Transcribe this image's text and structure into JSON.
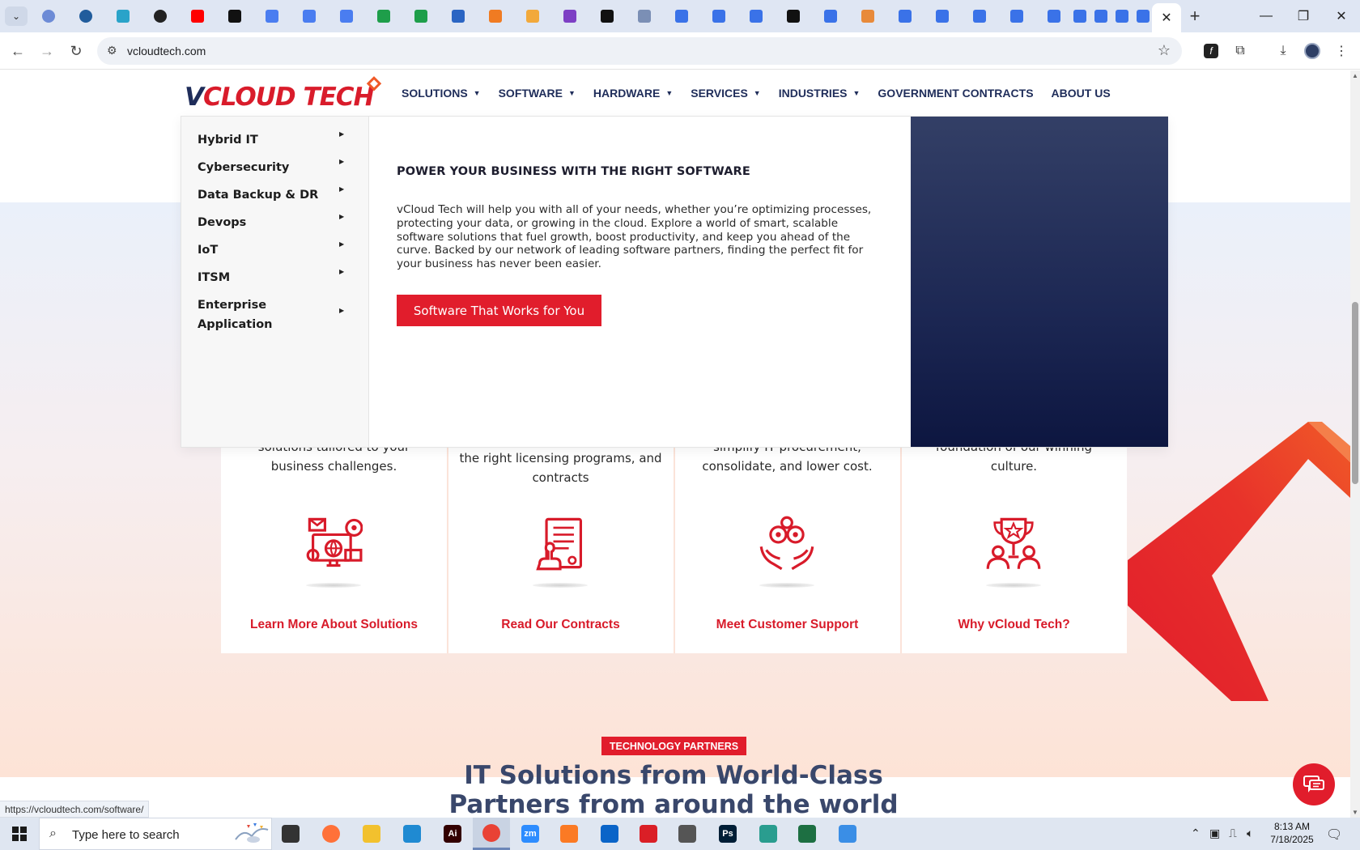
{
  "browser": {
    "tabs": [
      {
        "icon": "globe-half-icon",
        "color": "#6d8bd6"
      },
      {
        "icon": "shield-v-icon",
        "color": "#215c9c"
      },
      {
        "icon": "play-hex-icon",
        "color": "#2aa3c9"
      },
      {
        "icon": "openai-icon",
        "color": "#222222"
      },
      {
        "icon": "youtube-icon",
        "color": "#ff0000"
      },
      {
        "icon": "bolt-icon",
        "color": "#111111"
      },
      {
        "icon": "docs-icon",
        "color": "#4a7df0"
      },
      {
        "icon": "docs-icon",
        "color": "#4a7df0"
      },
      {
        "icon": "docs-icon",
        "color": "#4a7df0"
      },
      {
        "icon": "sheets-icon",
        "color": "#1e9e4a"
      },
      {
        "icon": "sheets-icon",
        "color": "#1e9e4a"
      },
      {
        "icon": "word-icon",
        "color": "#2b65c3"
      },
      {
        "icon": "xampp-icon",
        "color": "#f07b22"
      },
      {
        "icon": "vue-icon",
        "color": "#f2a93b"
      },
      {
        "icon": "braces-icon",
        "color": "#7d3fc4"
      },
      {
        "icon": "adobe-a-icon",
        "color": "#111111"
      },
      {
        "icon": "grid-icon",
        "color": "#7b8fb5"
      },
      {
        "icon": "form-icon",
        "color": "#3a72e8"
      },
      {
        "icon": "form-icon",
        "color": "#3a72e8"
      },
      {
        "icon": "form-icon",
        "color": "#3a72e8"
      },
      {
        "icon": "medium-icon",
        "color": "#111111"
      },
      {
        "icon": "form-icon",
        "color": "#3a72e8"
      },
      {
        "icon": "hand-icon",
        "color": "#e88a3a"
      },
      {
        "icon": "form-icon",
        "color": "#3a72e8"
      },
      {
        "icon": "form-icon",
        "color": "#3a72e8"
      },
      {
        "icon": "form-icon",
        "color": "#3a72e8"
      },
      {
        "icon": "form-icon",
        "color": "#3a72e8"
      },
      {
        "icon": "form-icon",
        "color": "#3a72e8"
      },
      {
        "icon": "form-icon",
        "color": "#3a72e8"
      },
      {
        "icon": "form-icon",
        "color": "#3a72e8"
      },
      {
        "icon": "form-icon",
        "color": "#3a72e8"
      },
      {
        "icon": "form-icon",
        "color": "#3a72e8"
      }
    ],
    "active_tab_close": "✕",
    "url": "vcloudtech.com",
    "status_url": "https://vcloudtech.com/software/"
  },
  "site": {
    "logo": {
      "prefix": "V",
      "text": "CLOUD TECH"
    },
    "nav": [
      {
        "label": "SOLUTIONS",
        "dropdown": true
      },
      {
        "label": "SOFTWARE",
        "dropdown": true
      },
      {
        "label": "HARDWARE",
        "dropdown": true
      },
      {
        "label": "SERVICES",
        "dropdown": true
      },
      {
        "label": "INDUSTRIES",
        "dropdown": true
      },
      {
        "label": "GOVERNMENT CONTRACTS",
        "dropdown": false
      },
      {
        "label": "ABOUT US",
        "dropdown": false
      }
    ],
    "megamenu": {
      "items": [
        {
          "label": "Hybrid IT"
        },
        {
          "label": "Cybersecurity"
        },
        {
          "label": "Data Backup & DR"
        },
        {
          "label": "Devops"
        },
        {
          "label": "IoT"
        },
        {
          "label": "ITSM"
        },
        {
          "label": "Enterprise Application"
        }
      ],
      "heading": "POWER YOUR BUSINESS WITH THE RIGHT SOFTWARE",
      "body": "vCloud Tech will help you with all of your needs, whether you’re optimizing processes, protecting your data, or growing in the cloud. Explore a world of smart, scalable software solutions that fuel growth, boost productivity, and keep you ahead of the curve. Backed by our network of leading software partners, finding the perfect fit for your business has never been easier.",
      "cta": "Software That Works for You"
    },
    "cards": [
      {
        "desc": "solutions tailored to your business challenges.",
        "link": "Learn More About Solutions",
        "icon": "computer-network-icon"
      },
      {
        "desc": "right-size software spending with the right licensing programs, and contracts",
        "link": "Read Our Contracts",
        "icon": "contract-document-icon"
      },
      {
        "desc": "simplify IT procurement, consolidate, and lower cost.",
        "link": "Meet Customer Support",
        "icon": "gears-hands-icon"
      },
      {
        "desc": "foundation of our winning culture.",
        "link": "Why vCloud Tech?",
        "icon": "trophy-team-icon"
      }
    ],
    "partners": {
      "badge": "TECHNOLOGY PARTNERS",
      "title": "IT Solutions from World-Class Partners from around the world"
    },
    "accent_color": "#e11d2c",
    "brand_navy": "#1f2d5a"
  },
  "taskbar": {
    "search_placeholder": "Type here to search",
    "apps": [
      {
        "name": "task-view",
        "label": "",
        "color": "#333333"
      },
      {
        "name": "firefox",
        "label": "",
        "color": "#ff7139"
      },
      {
        "name": "file-explorer",
        "label": "",
        "color": "#f2c12e"
      },
      {
        "name": "vscode",
        "label": "",
        "color": "#1f8ad2"
      },
      {
        "name": "illustrator",
        "label": "Ai",
        "color": "#330000"
      },
      {
        "name": "chrome",
        "label": "",
        "color": "#e94235"
      },
      {
        "name": "zoom",
        "label": "zm",
        "color": "#2d8cff"
      },
      {
        "name": "xampp",
        "label": "",
        "color": "#fb7a24"
      },
      {
        "name": "outlook",
        "label": "",
        "color": "#0a64c8"
      },
      {
        "name": "creative-cloud",
        "label": "",
        "color": "#da1f26"
      },
      {
        "name": "pen-tool",
        "label": "",
        "color": "#555555"
      },
      {
        "name": "photoshop",
        "label": "Ps",
        "color": "#001e36"
      },
      {
        "name": "app-gem",
        "label": "",
        "color": "#2a9d8f"
      },
      {
        "name": "excel",
        "label": "",
        "color": "#1d6f42"
      },
      {
        "name": "paint",
        "label": "",
        "color": "#3a8ee6"
      }
    ],
    "time": "8:13 AM",
    "date": "7/18/2025"
  }
}
